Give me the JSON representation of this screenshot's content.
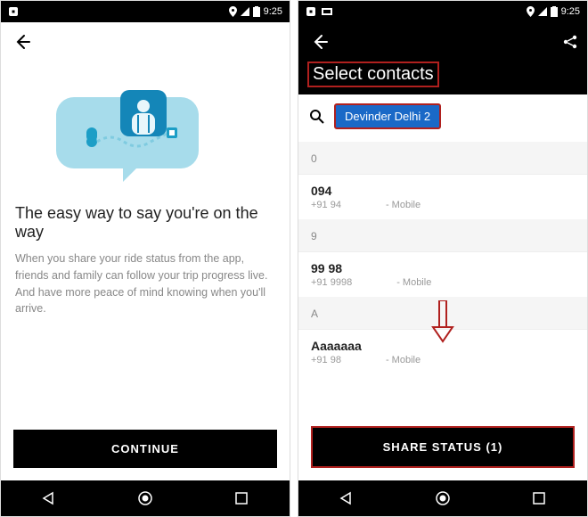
{
  "status": {
    "time": "9:25"
  },
  "screen1": {
    "headline": "The easy way to say you're on the way",
    "body": "When you share your ride status from the app, friends and family can follow your trip progress live. And have more peace of mind knowing when you'll arrive.",
    "cta": "CONTINUE"
  },
  "screen2": {
    "title": "Select contacts",
    "chip": "Devinder Delhi 2",
    "sections": [
      {
        "hdr": "0",
        "rows": [
          {
            "name": "094",
            "phone": "+91 94",
            "type": "- Mobile"
          }
        ]
      },
      {
        "hdr": "9",
        "rows": [
          {
            "name": "99 98",
            "phone": "+91 9998",
            "type": "- Mobile"
          }
        ]
      },
      {
        "hdr": "A",
        "rows": [
          {
            "name": "Aaaaaaa",
            "phone": "+91 98",
            "type": "- Mobile"
          }
        ]
      }
    ],
    "cta": "SHARE STATUS (1)"
  }
}
